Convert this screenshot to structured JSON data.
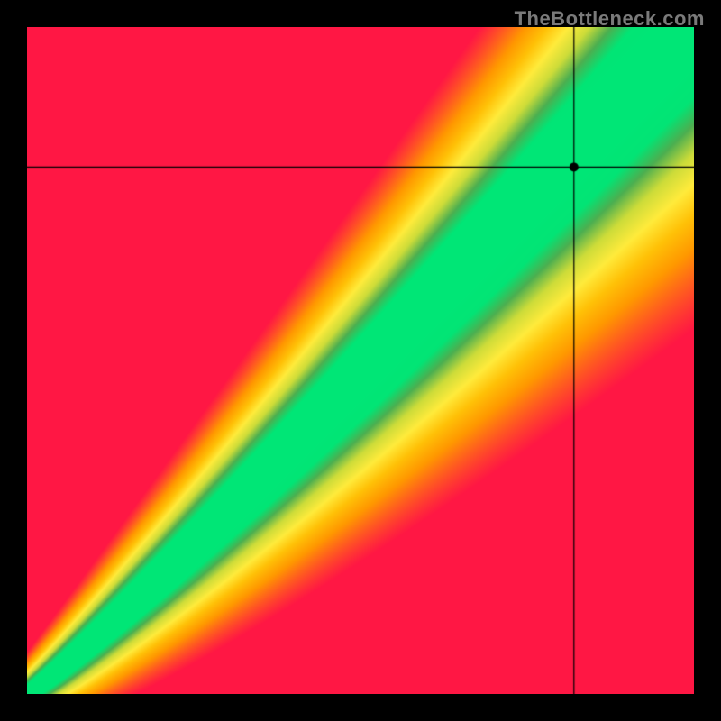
{
  "watermark": "TheBottleneck.com",
  "chart_data": {
    "type": "heatmap",
    "title": "",
    "xlabel": "",
    "ylabel": "",
    "xlim": [
      0,
      100
    ],
    "ylim": [
      0,
      100
    ],
    "colormap": [
      "#ff1744",
      "#ff5722",
      "#ff9800",
      "#ffc107",
      "#ffeb3b",
      "#cddc39",
      "#4caf50",
      "#00e676"
    ],
    "description": "Diagonal heatmap with green band along y=x curve, fading through yellow to orange/red away from diagonal",
    "crosshair": {
      "x": 82,
      "y": 79
    },
    "marker": {
      "x": 82,
      "y": 79,
      "color": "#000000"
    },
    "green_band_width_percent": 8,
    "yellow_band_width_percent": 18
  }
}
